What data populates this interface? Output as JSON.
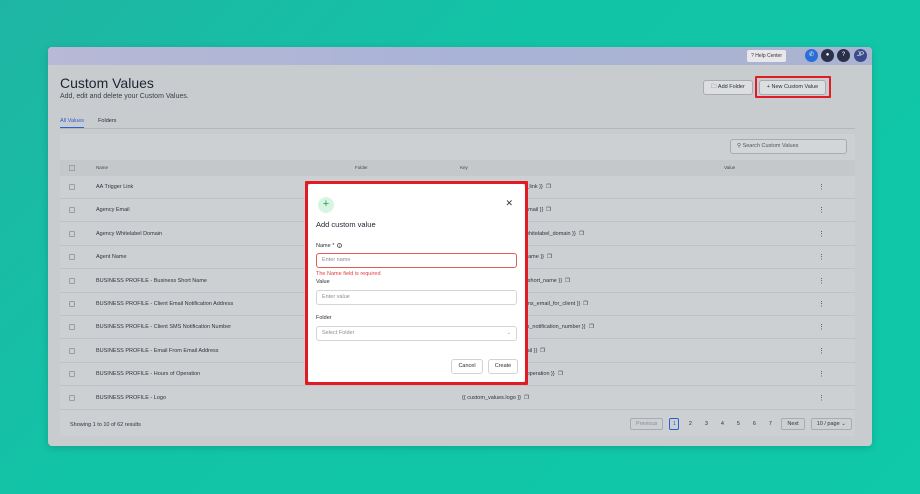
{
  "topbar": {
    "help_label": "? Help Center",
    "user_initials": "JP",
    "question_label": "?",
    "colors": {
      "phone": "#2b6fd6",
      "bell": "#2a2f4a",
      "help": "#2a2f4a",
      "avatar": "#3b4a8c"
    }
  },
  "header": {
    "title": "Custom Values",
    "subtitle": "Add, edit and delete your Custom Values.",
    "add_folder_label": "Add Folder",
    "new_custom_value_label": "+ New Custom Value"
  },
  "tabs": [
    {
      "label": "All Values",
      "active": true
    },
    {
      "label": "Folders",
      "active": false
    }
  ],
  "search": {
    "placeholder": "Search Custom Values"
  },
  "table": {
    "columns": [
      "Name",
      "Folder",
      "Key",
      "Value"
    ],
    "rows": [
      {
        "name": "AA Trigger Link",
        "key": "{{ custom_values.aa_trigger_link }}"
      },
      {
        "name": "Agency Email",
        "key": "{{ custom_values.agency_email }}"
      },
      {
        "name": "Agency Whitelabel Domain",
        "key": "{{ custom_values.agency_whitelabel_domain }}"
      },
      {
        "name": "Agent Name",
        "key": "{{ custom_values.agent_name }}"
      },
      {
        "name": "BUSINESS PROFILE - Business Short Name",
        "key": "{{ custom_values.business_short_name }}"
      },
      {
        "name": "BUSINESS PROFILE - Client Email Notification Address",
        "key": "{{ custom_values.notifications_email_for_client }}"
      },
      {
        "name": "BUSINESS PROFILE - Client SMS Notification Number",
        "key": "{{ custom_values.sms_notification_number }}"
      },
      {
        "name": "BUSINESS PROFILE - Email From Email Address",
        "key": "{{ custom_values.from_email }}"
      },
      {
        "name": "BUSINESS PROFILE - Hours of Operation",
        "key": "{{ custom_values.hours_of_operation }}"
      },
      {
        "name": "BUSINESS PROFILE - Logo",
        "key": "{{ custom_values.logo }}"
      }
    ],
    "visible_keys": [
      "el_link }}",
      "_email }}",
      "_whitelabel_domain }}",
      "_name }}",
      "s_short_name }}",
      "tions_email_for_client }}",
      "ms_notification_number }}",
      "mail }}",
      "f_operation }}",
      "{{ custom_values.logo }}"
    ]
  },
  "footer": {
    "showing": "Showing 1 to 10 of 62 results",
    "previous": "Previous",
    "pages": [
      "1",
      "2",
      "3",
      "4",
      "5",
      "6",
      "7"
    ],
    "next": "Next",
    "per_page": "10 / page"
  },
  "modal": {
    "title": "Add custom value",
    "name_label": "Name *",
    "name_placeholder": "Enter name",
    "name_error": "The Name field is required",
    "value_label": "Value",
    "value_placeholder": "Enter value",
    "folder_label": "Folder",
    "folder_placeholder": "Select Folder",
    "cancel_label": "Cancel",
    "create_label": "Create"
  }
}
